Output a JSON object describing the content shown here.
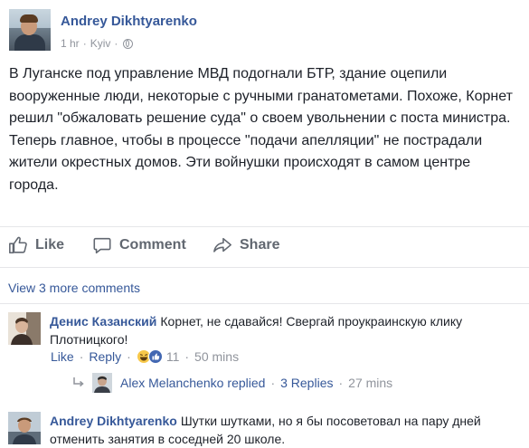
{
  "post": {
    "author": "Andrey Dikhtyarenko",
    "time": "1 hr",
    "separator": "·",
    "location": "Kyiv",
    "text_paragraphs": [
      "В Луганске под управление МВД подогнали БТР, здание оцепили вооруженные люди, некоторые с ручными гранатометами. Похоже, Корнет решил \"обжаловать решение суда\" о своем увольнении с поста министра.",
      "Теперь главное, чтобы в процессе \"подачи апелляции\" не пострадали жители окрестных домов. Эти войнушки происходят в самом центре города."
    ]
  },
  "actions": {
    "like": "Like",
    "comment": "Comment",
    "share": "Share"
  },
  "comments_section": {
    "view_more": "View 3 more comments",
    "comments": [
      {
        "author": "Денис Казанский",
        "text": "Корнет, не сдавайся! Свергай проукраинскую клику Плотницкого!",
        "like_label": "Like",
        "reply_label": "Reply",
        "reaction_count": "11",
        "time": "50 mins"
      },
      {
        "author": "Andrey Dikhtyarenko",
        "text": "Шутки шутками, но я бы посоветовал на пару дней отменить занятия в соседней 20 школе."
      }
    ],
    "replies": {
      "author": "Alex Melanchenko",
      "replied_label": "replied",
      "count_label": "3 Replies",
      "time": "27 mins"
    }
  },
  "colors": {
    "link_blue": "#365899",
    "meta_gray": "#90949c",
    "action_gray": "#616770",
    "text": "#1d2129"
  },
  "icons": [
    "globe-icon",
    "like-thumb-icon",
    "comment-bubble-icon",
    "share-arrow-icon",
    "reply-arrow-icon",
    "haha-reaction-icon",
    "like-reaction-icon"
  ]
}
